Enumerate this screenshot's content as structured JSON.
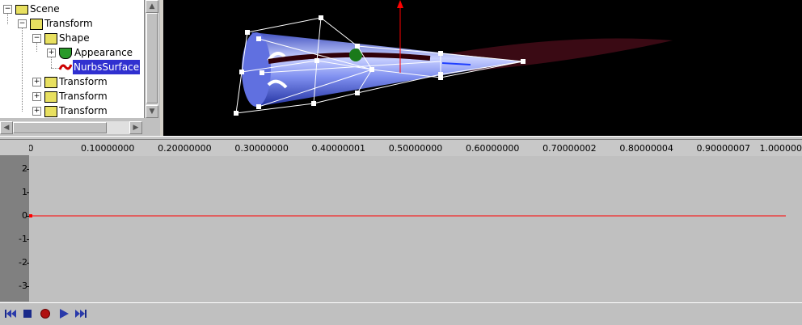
{
  "tree": {
    "items": [
      {
        "label": "Scene",
        "expander": "−"
      },
      {
        "label": "Transform",
        "expander": "−"
      },
      {
        "label": "Shape",
        "expander": "−"
      },
      {
        "label": "Appearance",
        "expander": "+"
      },
      {
        "label": "NurbsSurface",
        "selected": true
      },
      {
        "label": "Transform",
        "expander": "+"
      },
      {
        "label": "Transform",
        "expander": "+"
      },
      {
        "label": "Transform",
        "expander": "+"
      }
    ]
  },
  "timeline": {
    "ticks": [
      "0",
      "0.10000000",
      "0.20000000",
      "0.30000000",
      "0.40000001",
      "0.50000000",
      "0.60000000",
      "0.70000002",
      "0.80000004",
      "0.90000007",
      "1.000000"
    ],
    "y_labels": [
      "2",
      "1",
      "0",
      "-1",
      "-2",
      "-3"
    ],
    "curve_value": 0,
    "curve_color": "#ff0000"
  },
  "colors": {
    "viewport_bg": "#000000",
    "selection": "#3030d0",
    "axis_arrow": "#ff0000"
  },
  "toolbar": {
    "buttons": [
      "rewind-icon",
      "stop-icon",
      "record-icon",
      "play-icon",
      "fast-forward-icon"
    ]
  }
}
